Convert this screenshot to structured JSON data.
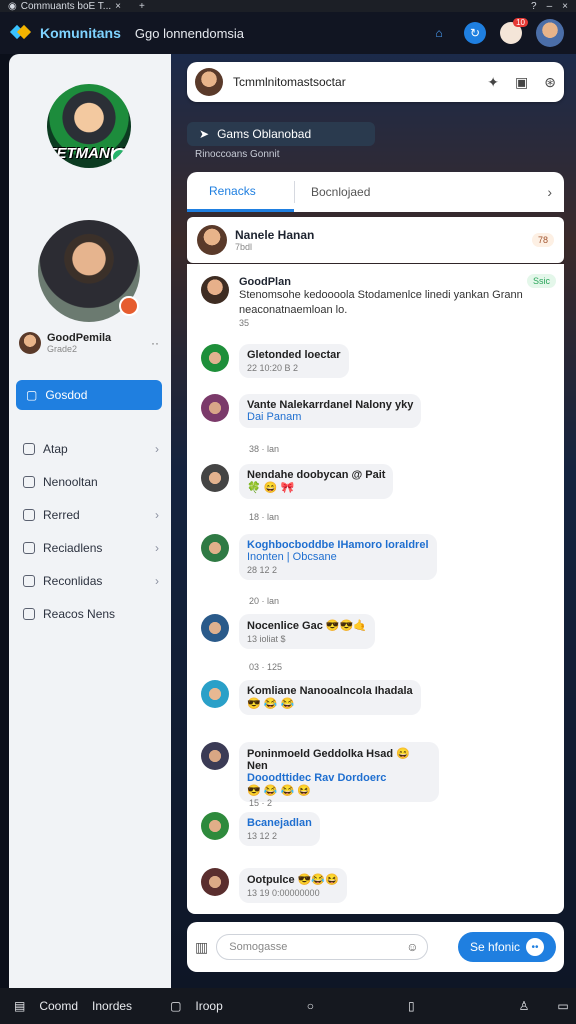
{
  "browser": {
    "tab_title": "Commuants boE T...",
    "right_icons": [
      "help-icon",
      "minimize-icon",
      "close-icon"
    ]
  },
  "appbar": {
    "brand": "Komunitans",
    "breadcrumb": "Ggo lonnendomsia",
    "notif_count": "10"
  },
  "sidebar": {
    "avatar_text": "TETMANUS",
    "profile_name": "GoodPemila",
    "profile_sub": "Grade2",
    "active_nav": "Gosdod",
    "items": [
      {
        "label": "Atap",
        "chevron": true
      },
      {
        "label": "Nenooltan",
        "chevron": false
      },
      {
        "label": "Rerred",
        "chevron": true
      },
      {
        "label": "Reciadlens",
        "chevron": true
      },
      {
        "label": "Reconlidas",
        "chevron": true
      },
      {
        "label": "Reacos Nens",
        "chevron": false
      }
    ]
  },
  "topcard": {
    "title": "Tcmmlnitomastsoctar"
  },
  "game": {
    "pill": "Gams Oblanobad",
    "sub": "Rinoccoans Gonnit"
  },
  "tabs": {
    "active": "Renacks",
    "other": "Bocnlojaed"
  },
  "pinned": {
    "name": "Nanele Hanan",
    "sub": "7bdl",
    "react": "78"
  },
  "first_post": {
    "name": "GoodPlan",
    "text": "Stenomsohe kedoooola Stodamenlce linedi yankan Grann neaconatnaemloan lo.",
    "meta": "35",
    "badge": "Ssic"
  },
  "messages": [
    {
      "name": "Gletonded loectar",
      "meta": "22 10:20 B 2",
      "time": ""
    },
    {
      "name": "Vante Nalekarrdanel Nalony yky",
      "line2": "Dai Panam",
      "time": "38 · lan"
    },
    {
      "name": "Nendahe doobycan @ Pait",
      "line2": "🍀 😄 🎀",
      "time": "18 · lan"
    },
    {
      "name": "Koghbocboddbe IHamoro loraldrel",
      "line2": "Inonten | Obcsane",
      "meta": "28 12 2",
      "time": "20 · lan"
    },
    {
      "name": "Nocenlice Gac 😎😎🤙",
      "line2": "",
      "meta": "13 ioliat $",
      "time": "03 · 125"
    },
    {
      "name": "Komliane Nanooalncola Ihadala",
      "line2": "😎 😂 😂",
      "time": ""
    },
    {
      "name": "Poninmoeld Geddolka Hsad 😄 Nen",
      "line2": "Dooodttidec Rav Dordoerc",
      "meta": "😎 😂 😂 😆",
      "time": "15 · 2"
    },
    {
      "name": "Bcanejadlan",
      "line2": "13 12 2",
      "time": ""
    },
    {
      "name": "Ootpulce 😎😂😆",
      "line2": "13 19 0:00000000",
      "time": ""
    }
  ],
  "composer": {
    "placeholder": "Somogasse",
    "send": "Se hfonic"
  },
  "bottombar": {
    "left1": "Coomd",
    "left2": "Inordes",
    "left3": "Iroop"
  }
}
